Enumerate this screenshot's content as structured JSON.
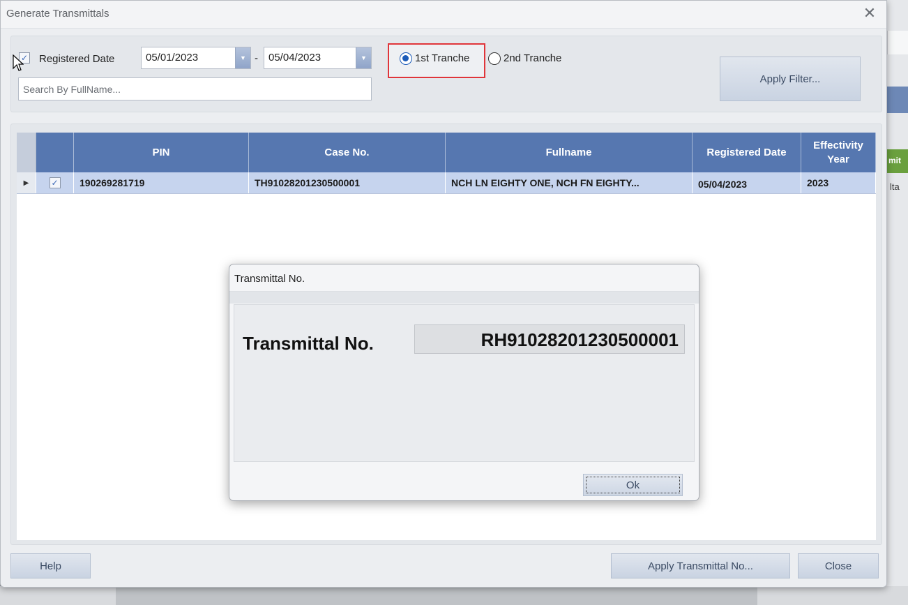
{
  "window": {
    "title": "Generate Transmittals"
  },
  "filter": {
    "registered_date_label": "Registered Date",
    "registered_date_checked": true,
    "date_from": "05/01/2023",
    "date_separator": "-",
    "date_to": "05/04/2023",
    "search_placeholder": "Search By FullName...",
    "tranche_options": [
      {
        "label": "1st Tranche",
        "selected": true
      },
      {
        "label": "2nd Tranche",
        "selected": false
      }
    ],
    "apply_filter_label": "Apply Filter..."
  },
  "grid": {
    "columns": [
      "PIN",
      "Case No.",
      "Fullname",
      "Registered Date",
      "Effectivity Year"
    ],
    "rows": [
      {
        "checked": true,
        "pin": "190269281719",
        "case_no": "TH91028201230500001",
        "fullname": "NCH LN EIGHTY ONE, NCH FN EIGHTY...",
        "registered_date": "05/04/2023",
        "effectivity_year": "2023"
      }
    ]
  },
  "footer": {
    "help_label": "Help",
    "apply_transmittal_label": "Apply Transmittal No...",
    "close_label": "Close"
  },
  "dialog": {
    "title": "Transmittal No.",
    "field_label": "Transmittal No.",
    "field_value": "RH91028201230500001",
    "ok_label": "Ok"
  },
  "background_app": {
    "green_button_fragment": "mit",
    "text_fragment": "lta"
  },
  "colors": {
    "grid_header": "#5677b0",
    "selected_row": "#c6d4ee",
    "highlight_box": "#e0353a",
    "radio_selected": "#1c5bb8"
  }
}
